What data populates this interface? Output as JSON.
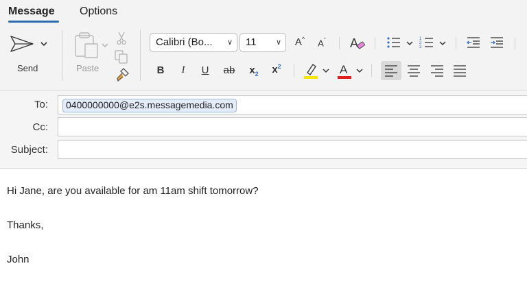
{
  "tabs": [
    {
      "label": "Message",
      "active": true
    },
    {
      "label": "Options",
      "active": false
    }
  ],
  "toolbar": {
    "send_label": "Send",
    "paste_label": "Paste",
    "font_name": "Calibri (Bo...",
    "font_size": "11",
    "accent_color": "#2b6cb0",
    "highlight_color": "#f5e50a",
    "font_color": "#e02020"
  },
  "headers": {
    "to_label": "To:",
    "cc_label": "Cc:",
    "subject_label": "Subject:",
    "to_recipient": "0400000000@e2s.messagemedia.com",
    "cc_value": "",
    "subject_value": ""
  },
  "body": {
    "line1": "Hi Jane, are you available for am 11am shift tomorrow?",
    "line2": "Thanks,",
    "line3": "John"
  }
}
